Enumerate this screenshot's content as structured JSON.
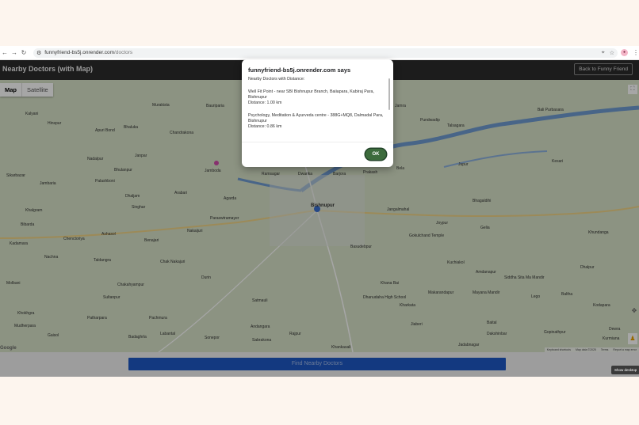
{
  "browser": {
    "back": "←",
    "forward": "→",
    "reload": "↻",
    "url_host": "funnyfriend-bs5j.onrender.com",
    "url_path": "/doctors",
    "avatar": "●",
    "menu": "⋮"
  },
  "header": {
    "title": "Nearby Doctors (with Map)",
    "back_button": "Back to Funny Friend"
  },
  "map": {
    "type_map": "Map",
    "type_satellite": "Satellite",
    "google": "Google",
    "attribution": [
      "Keyboard shortcuts",
      "Map data ©2025",
      "Terms",
      "Report a map error"
    ],
    "places": [
      "Kalyani",
      "Hinspur",
      "Murakista",
      "Bauriparia",
      "Apuri Bond",
      "Bhaluka",
      "Chandrakona",
      "Jamra",
      "Pundwadip",
      "Talsagara",
      "Bali Purbasara",
      "Sikarbazar",
      "Jambaria",
      "Janpar",
      "Nadalpur",
      "Bhulanpur",
      "Jamboda",
      "Ramsagar",
      "Dwarika",
      "Barjora",
      "Prakash",
      "Bela",
      "Jupur",
      "Kesari",
      "Palashboni",
      "Dhaljam",
      "Arabari",
      "Singhar",
      "Agarda",
      "Bishnupur",
      "Jangalmahal",
      "Bhagaldihi",
      "Khalgram",
      "Paraswtramayer",
      "Agarda Paraswtramayer",
      "Joypur",
      "Bibarda",
      "Ashasol",
      "Nakaijuri",
      "Gokulchand Temple",
      "Gelia",
      "Khundanga",
      "Chenctoriya",
      "Benajari",
      "Basudebpur",
      "Kadamara",
      "Nachna",
      "Taldangra",
      "Chak Nakajuri",
      "Kuchiakol",
      "Dhalpur",
      "Molbani",
      "Durin",
      "Khana Bai",
      "Amdanapur",
      "Siddha Sita Ma Mandir",
      "Chakahyampur",
      "Dhanudaha High School",
      "Makarandapur",
      "Mayana Mandir",
      "Lego",
      "Baltha",
      "Pachmura",
      "Satmauli",
      "Kharkata",
      "Kodapara",
      "Sultanpur",
      "Andangara",
      "Rajpur",
      "Jiaberi",
      "Baital",
      "Patharpara",
      "Khokhgra",
      "Mudherpara",
      "Badaghrla",
      "Labantal",
      "Sonepor",
      "Sabrakona",
      "Khankasali",
      "Dakshinbar",
      "Gopinathpur",
      "Jadabnagar",
      "Gaisol",
      "Dewra",
      "Kurmiana"
    ],
    "fullscreen": "⛶",
    "pegman": "♟",
    "compass": "✥"
  },
  "find_button": "Find Nearby Doctors",
  "dialog": {
    "title": "funnyfriend-bs5j.onrender.com says",
    "heading": "Nearby Doctors with Distance:",
    "entries": [
      {
        "name": "Well Fit Point - near SBI Bishnupur Branch, Baiiapara, Kabiraj Para, Bishnupur",
        "distance": "Distance: 1.00 km"
      },
      {
        "name": "Psychology, Meditation & Ayurveda centre - 388G+MQ8, Dalmadal Para, Bishnupur",
        "distance": "Distance: 0.86 km"
      }
    ],
    "ok": "OK"
  },
  "tooltip": "Show desktop",
  "colors": {
    "map_bg": "#d7e2c8",
    "river": "#6f9bd1",
    "header_bg": "#2b2b2b",
    "find_button": "#1e58c5",
    "ok_button": "#3c6b3c"
  }
}
